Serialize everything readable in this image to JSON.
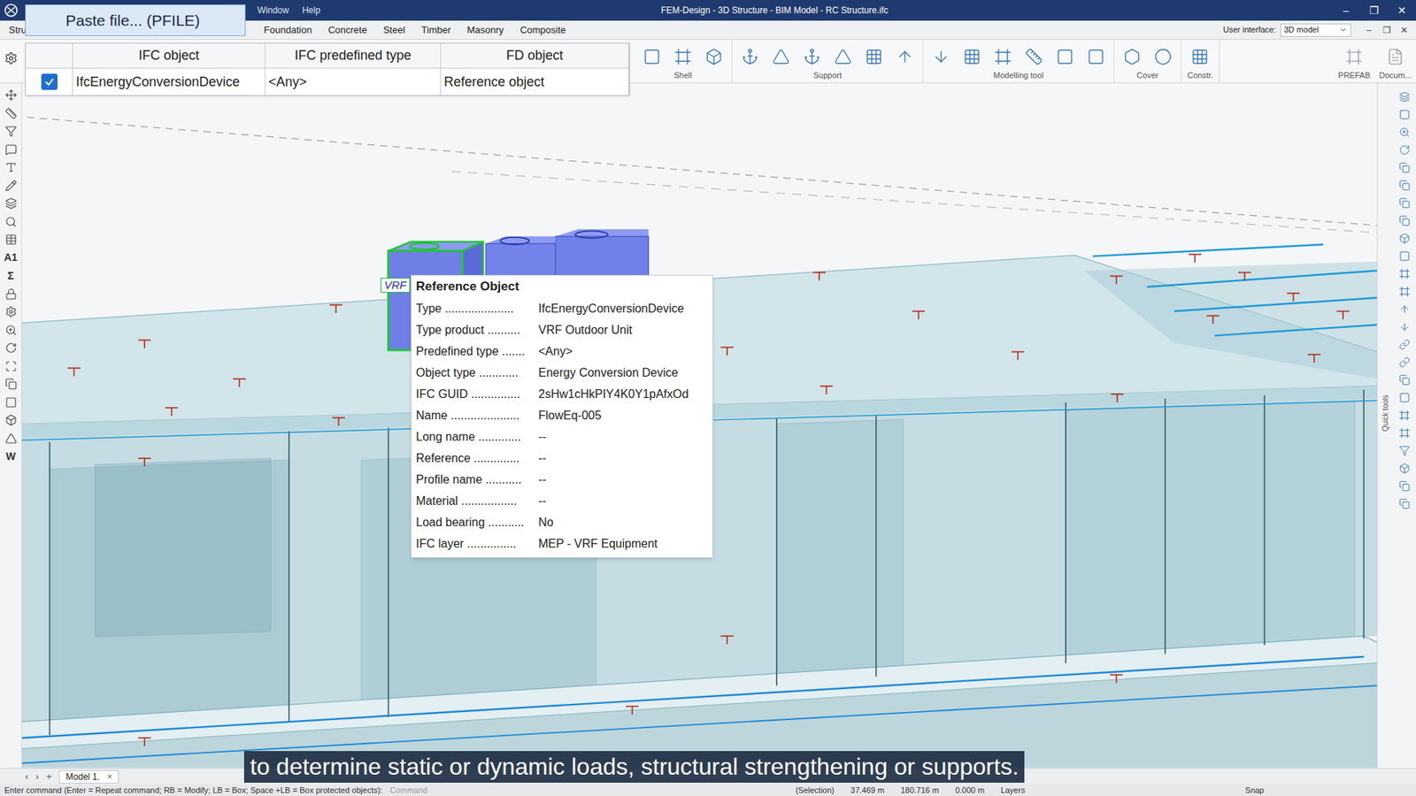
{
  "window": {
    "title": "FEM-Design - 3D Structure - BIM Model - RC Structure.ifc",
    "controls": [
      "–",
      "❐",
      "✕"
    ]
  },
  "title_menu": [
    "Window",
    "Help"
  ],
  "paste_button": {
    "label": "Paste file... (PFILE)"
  },
  "mapping_table": {
    "columns": [
      "IFC object",
      "IFC predefined type",
      "FD object"
    ],
    "rows": [
      {
        "checked": true,
        "cells": [
          "IfcEnergyConversionDevice",
          "<Any>",
          "Reference object"
        ]
      }
    ]
  },
  "menu_tabs": [
    {
      "label": "Stru"
    },
    {
      "label": "Foundation"
    },
    {
      "label": "Concrete"
    },
    {
      "label": "Steel"
    },
    {
      "label": "Timber"
    },
    {
      "label": "Masonry"
    },
    {
      "label": "Composite"
    }
  ],
  "user_interface": {
    "label": "User interface:",
    "value": "3D model"
  },
  "mdi_controls": [
    "–",
    "❐",
    "✕"
  ],
  "ribbon_groups": [
    {
      "label": "Shell"
    },
    {
      "label": "Support"
    },
    {
      "label": "Modelling tool"
    },
    {
      "label": "Cover"
    },
    {
      "label": "Constr."
    },
    {
      "label": "PREFAB"
    },
    {
      "label": "Docum..."
    }
  ],
  "left_toolbar": [
    {
      "kind": "icon"
    },
    {
      "kind": "icon"
    },
    {
      "kind": "icon"
    },
    {
      "kind": "icon"
    },
    {
      "kind": "icon"
    },
    {
      "kind": "icon"
    },
    {
      "kind": "icon"
    },
    {
      "kind": "icon"
    },
    {
      "kind": "icon"
    },
    {
      "kind": "glyph",
      "text": "A1"
    },
    {
      "kind": "glyph",
      "text": "Σ"
    },
    {
      "kind": "icon"
    },
    {
      "kind": "icon"
    },
    {
      "kind": "icon"
    },
    {
      "kind": "icon"
    },
    {
      "kind": "icon"
    },
    {
      "kind": "icon"
    },
    {
      "kind": "icon"
    },
    {
      "kind": "icon"
    },
    {
      "kind": "icon"
    },
    {
      "kind": "glyph",
      "text": "W"
    }
  ],
  "object_label": "VRF",
  "tooltip": {
    "title": "Reference Object",
    "rows": [
      {
        "label": "Type .....................",
        "value": "IfcEnergyConversionDevice"
      },
      {
        "label": "Type product ..........",
        "value": "VRF Outdoor Unit"
      },
      {
        "label": "Predefined type .......",
        "value": "<Any>"
      },
      {
        "label": "Object type ............",
        "value": "Energy Conversion Device"
      },
      {
        "label": "IFC GUID ...............",
        "value": "2sHw1cHkPIY4K0Y1pAfxOd"
      },
      {
        "label": "Name .....................",
        "value": "FlowEq-005"
      },
      {
        "label": "Long name .............",
        "value": "--"
      },
      {
        "label": "Reference ..............",
        "value": "--"
      },
      {
        "label": "Profile name ...........",
        "value": "--"
      },
      {
        "label": "Material .................",
        "value": "--"
      },
      {
        "label": "Load bearing ...........",
        "value": "No"
      },
      {
        "label": "IFC layer ...............",
        "value": "MEP - VRF Equipment"
      }
    ]
  },
  "quick_tools_label": "Quick tools",
  "model_tab_nav": [
    "‹",
    "›",
    "+"
  ],
  "model_tabs": [
    {
      "label": "Model 1.",
      "selected": true,
      "close": "×"
    }
  ],
  "status_bar": {
    "prompt": "Enter command (Enter = Repeat command; RB = Modify; LB = Box; Space +LB = Box protected objects):",
    "command": "Command",
    "fields": [
      "(Selection)",
      "37.469 m",
      "180.716 m",
      "0.000 m",
      "Layers"
    ],
    "snap": "Snap"
  },
  "subtitle": "to determine static or dynamic loads, structural strengthening or supports."
}
